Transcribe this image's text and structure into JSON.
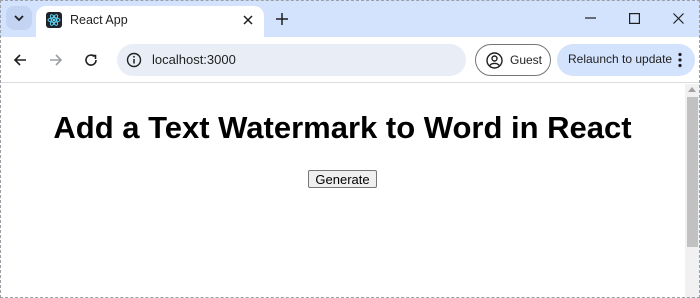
{
  "tab": {
    "title": "React App"
  },
  "toolbar": {
    "url": "localhost:3000",
    "profile_label": "Guest",
    "relaunch_label": "Relaunch to update"
  },
  "page": {
    "title": "Add a Text Watermark to Word in React",
    "generate_label": "Generate"
  },
  "icons": {
    "tab_search": "chevron-down-icon",
    "favicon": "react-logo-icon",
    "tab_close": "close-icon",
    "new_tab": "plus-icon",
    "minimize": "minimize-icon",
    "maximize": "maximize-icon",
    "close_window": "close-icon",
    "back": "arrow-left-icon",
    "forward": "arrow-right-icon",
    "reload": "reload-icon",
    "site_info": "info-icon",
    "profile": "person-icon",
    "menu": "more-vertical-icon"
  },
  "colors": {
    "tabstrip_bg": "#d3e3fd",
    "omnibox_bg": "#e9eef6",
    "relaunch_bg": "#d3e3fd"
  }
}
